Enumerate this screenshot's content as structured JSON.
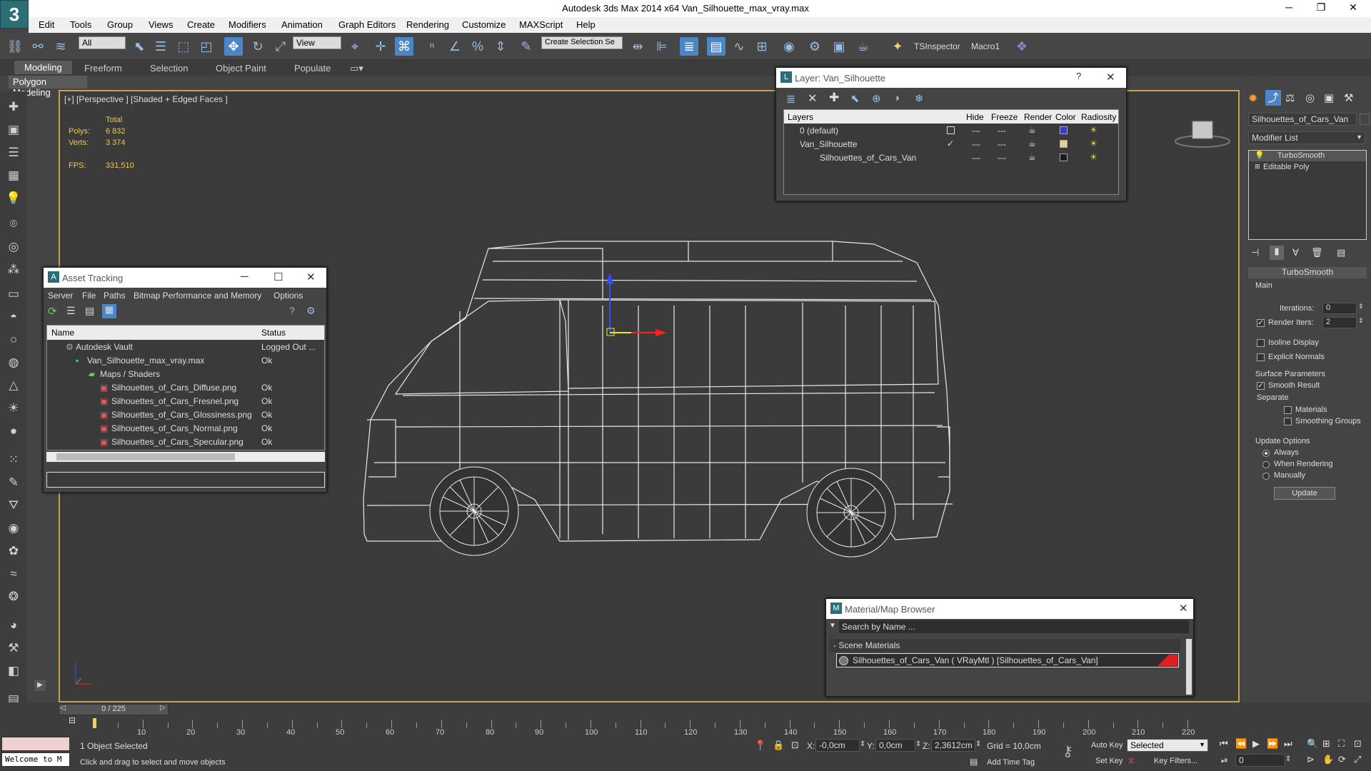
{
  "window": {
    "title": "Autodesk 3ds Max  2014 x64    Van_Silhouette_max_vray.max"
  },
  "menu": [
    "Edit",
    "Tools",
    "Group",
    "Views",
    "Create",
    "Modifiers",
    "Animation",
    "Graph Editors",
    "Rendering",
    "Customize",
    "MAXScript",
    "Help"
  ],
  "toolbar": {
    "filter": "All",
    "ref_coord": "View",
    "selection_set": "Create Selection Se",
    "ts_inspector": "TSInspector",
    "macro": "Macro1"
  },
  "ribbon": {
    "tabs": [
      "Modeling",
      "Freeform",
      "Selection",
      "Object Paint",
      "Populate"
    ],
    "sub": "Polygon Modeling"
  },
  "viewport": {
    "label": "[+] [Perspective ] [Shaded + Edged Faces ]",
    "total_label": "Total",
    "polys_label": "Polys:",
    "polys": "6 832",
    "verts_label": "Verts:",
    "verts": "3 374",
    "fps_label": "FPS:",
    "fps": "331,510"
  },
  "layer_dialog": {
    "title": "Layer: Van_Silhouette",
    "columns": [
      "Layers",
      "Hide",
      "Freeze",
      "Render",
      "Color",
      "Radiosity"
    ],
    "rows": [
      {
        "name": "0 (default)",
        "color": "#3838d8"
      },
      {
        "name": "Van_Silhouette",
        "color": "#e8d088"
      },
      {
        "name": "Silhouettes_of_Cars_Van",
        "color": "#1a1a1a"
      }
    ]
  },
  "asset_tracking": {
    "title": "Asset Tracking",
    "menu": [
      "Server",
      "File",
      "Paths",
      "Bitmap Performance and Memory",
      "Options"
    ],
    "columns": [
      "Name",
      "Status"
    ],
    "rows": [
      {
        "name": "Autodesk Vault",
        "status": "Logged Out ..."
      },
      {
        "name": "Van_Silhouette_max_vray.max",
        "status": "Ok"
      },
      {
        "name": "Maps / Shaders",
        "status": ""
      },
      {
        "name": "Silhouettes_of_Cars_Diffuse.png",
        "status": "Ok"
      },
      {
        "name": "Silhouettes_of_Cars_Fresnel.png",
        "status": "Ok"
      },
      {
        "name": "Silhouettes_of_Cars_Glossiness.png",
        "status": "Ok"
      },
      {
        "name": "Silhouettes_of_Cars_Normal.png",
        "status": "Ok"
      },
      {
        "name": "Silhouettes_of_Cars_Specular.png",
        "status": "Ok"
      }
    ]
  },
  "material_browser": {
    "title": "Material/Map Browser",
    "search_placeholder": "Search by Name ...",
    "section": "- Scene Materials",
    "item": "Silhouettes_of_Cars_Van ( VRayMtl ) [Silhouettes_of_Cars_Van]"
  },
  "command_panel": {
    "object_name": "Silhouettes_of_Cars_Van",
    "modifier_list": "Modifier List",
    "stack": [
      "TurboSmooth",
      "Editable Poly"
    ],
    "rollout_title": "TurboSmooth",
    "main_group": "Main",
    "iterations_label": "Iterations:",
    "iterations": "0",
    "render_iters_label": "Render Iters:",
    "render_iters": "2",
    "isoline": "Isoline Display",
    "explicit_normals": "Explicit Normals",
    "surface_params": "Surface Parameters",
    "smooth_result": "Smooth Result",
    "separate": "Separate",
    "materials": "Materials",
    "smoothing_groups": "Smoothing Groups",
    "update_options": "Update Options",
    "always": "Always",
    "when_rendering": "When Rendering",
    "manually": "Manually",
    "update_button": "Update"
  },
  "timeline": {
    "frame": "0 / 225",
    "ticks": [
      "10",
      "20",
      "30",
      "40",
      "50",
      "60",
      "70",
      "80",
      "90",
      "100",
      "110",
      "120",
      "130",
      "140",
      "150",
      "160",
      "170",
      "180",
      "190",
      "200",
      "210",
      "220"
    ]
  },
  "status": {
    "maxscript": "Welcome to M",
    "selected": "1 Object Selected",
    "prompt": "Click and drag to select and move objects",
    "x_label": "X:",
    "x": "-0,0cm",
    "y_label": "Y:",
    "y": "0,0cm",
    "z_label": "Z:",
    "z": "2,3612cm",
    "grid": "Grid = 10,0cm",
    "add_time_tag": "Add Time Tag",
    "auto_key": "Auto Key",
    "set_key": "Set Key",
    "key_mode": "Selected",
    "key_filters": "Key Filters...",
    "current_frame": "0"
  }
}
